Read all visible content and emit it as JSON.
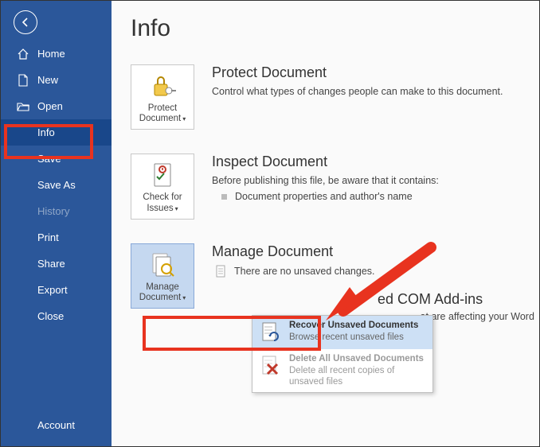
{
  "page_title": "Info",
  "sidebar": {
    "items": [
      {
        "label": "Home"
      },
      {
        "label": "New"
      },
      {
        "label": "Open"
      },
      {
        "label": "Info"
      },
      {
        "label": "Save"
      },
      {
        "label": "Save As"
      },
      {
        "label": "History"
      },
      {
        "label": "Print"
      },
      {
        "label": "Share"
      },
      {
        "label": "Export"
      },
      {
        "label": "Close"
      }
    ],
    "account_label": "Account"
  },
  "protect": {
    "tile_label": "Protect Document",
    "title": "Protect Document",
    "desc": "Control what types of changes people can make to this document."
  },
  "inspect": {
    "tile_label": "Check for Issues",
    "title": "Inspect Document",
    "desc": "Before publishing this file, be aware that it contains:",
    "bullet1": "Document properties and author's name"
  },
  "manage": {
    "tile_label": "Manage Document",
    "title": "Manage Document",
    "nodocs": "There are no unsaved changes."
  },
  "dropdown": {
    "recover_title": "Recover Unsaved Documents",
    "recover_sub": "Browse recent unsaved files",
    "delete_title": "Delete All Unsaved Documents",
    "delete_sub": "Delete all recent copies of unsaved files"
  },
  "partial": {
    "title_suffix": "ed COM Add-ins",
    "desc_suffix": "at are affecting your Word experience."
  }
}
